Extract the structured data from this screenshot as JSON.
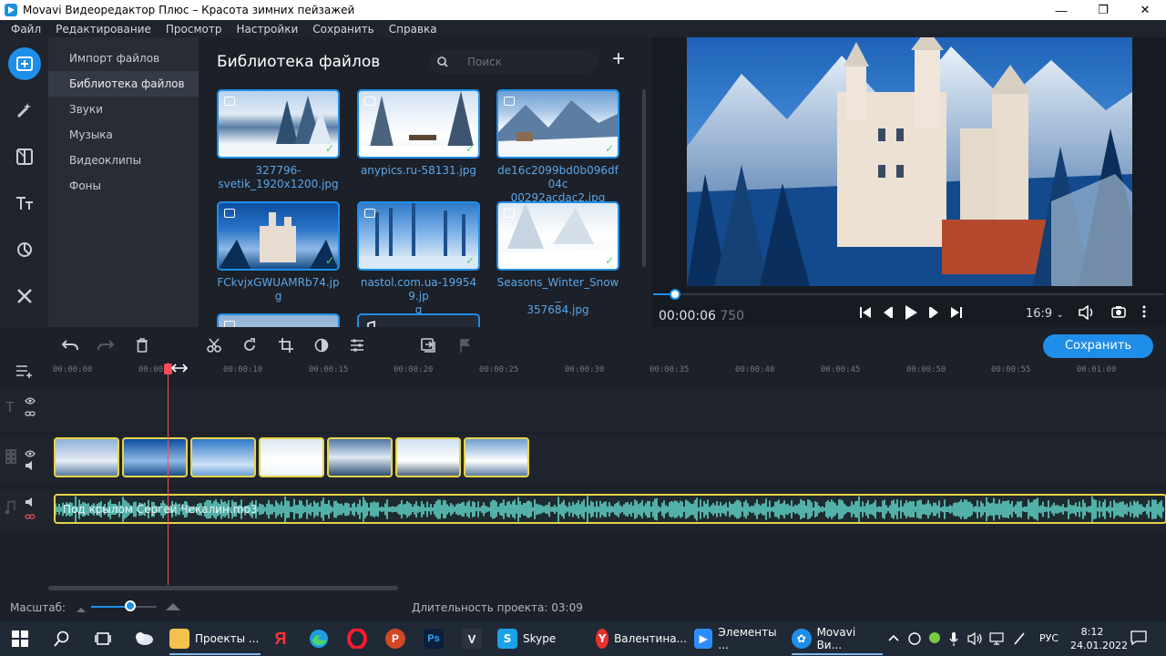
{
  "window": {
    "title": "Movavi Видеоредактор Плюс – Красота зимних пейзажей",
    "minimize": "—",
    "maximize": "❐",
    "close": "✕"
  },
  "menu": [
    "Файл",
    "Редактирование",
    "Просмотр",
    "Настройки",
    "Сохранить",
    "Справка"
  ],
  "rail_icons": [
    "import-icon",
    "magic-wand-icon",
    "transitions-icon",
    "titles-icon",
    "filters-icon",
    "tools-icon"
  ],
  "library_nav": {
    "items": [
      "Импорт файлов",
      "Библиотека файлов",
      "Звуки",
      "Музыка",
      "Видеоклипы",
      "Фоны"
    ],
    "selected": "Библиотека файлов"
  },
  "library": {
    "title": "Библиотека файлов",
    "search_placeholder": "Поиск",
    "files": [
      {
        "name": "327796-svetik_1920x1200.jpg",
        "line1": "327796-",
        "line2": "svetik_1920x1200.jpg",
        "used": true
      },
      {
        "name": "anypics.ru-58131.jpg",
        "line1": "anypics.ru-58131.jpg",
        "line2": "",
        "used": true
      },
      {
        "name": "de16c2099bd0b096df04c00292acdac2.jpg",
        "line1": "de16c2099bd0b096df04c",
        "line2": "00292acdac2.jpg",
        "used": true
      },
      {
        "name": "FCkvjxGWUAMRb74.jpg",
        "line1": "FCkvjxGWUAMRb74.jpg",
        "line2": "",
        "used": true
      },
      {
        "name": "nastol.com.ua-199549.jpg",
        "line1": "nastol.com.ua-199549.jp",
        "line2": "g",
        "used": true
      },
      {
        "name": "Seasons_Winter_Snow_357684.jpg",
        "line1": "Seasons_Winter_Snow_",
        "line2": "357684.jpg",
        "used": true
      }
    ]
  },
  "preview": {
    "timecode": "00:00:06",
    "timecode_ms": "750",
    "aspect_ratio": "16:9",
    "progress_fraction": 0.043
  },
  "timeline": {
    "save_label": "Сохранить",
    "ruler": [
      "00:00:00",
      "00:00:",
      "00:00:10",
      "00:00:15",
      "00:00:20",
      "00:00:25",
      "00:00:30",
      "00:00:35",
      "00:00:40",
      "00:00:45",
      "00:00:50",
      "00:00:55",
      "00:01:00"
    ],
    "audio_clip_name": "Под крылом Сергей Чекалин.mp3",
    "video_clip_count": 7
  },
  "status": {
    "zoom_label": "Масштаб:",
    "zoom_fraction": 0.6,
    "duration_label": "Длительность проекта:",
    "duration_value": "03:09"
  },
  "taskbar": {
    "apps": [
      {
        "label": "Проекты ...",
        "color": "#f2c14e"
      },
      {
        "label": "Skype",
        "color": "#1aa3e8"
      },
      {
        "label": "Валентина...",
        "color": "#e8312a"
      },
      {
        "label": "Элементы ...",
        "color": "#2d8cff"
      },
      {
        "label": "Movavi Ви...",
        "color": "#1f8ee8"
      }
    ],
    "lang": "РУС",
    "time": "8:12",
    "date": "24.01.2022"
  }
}
